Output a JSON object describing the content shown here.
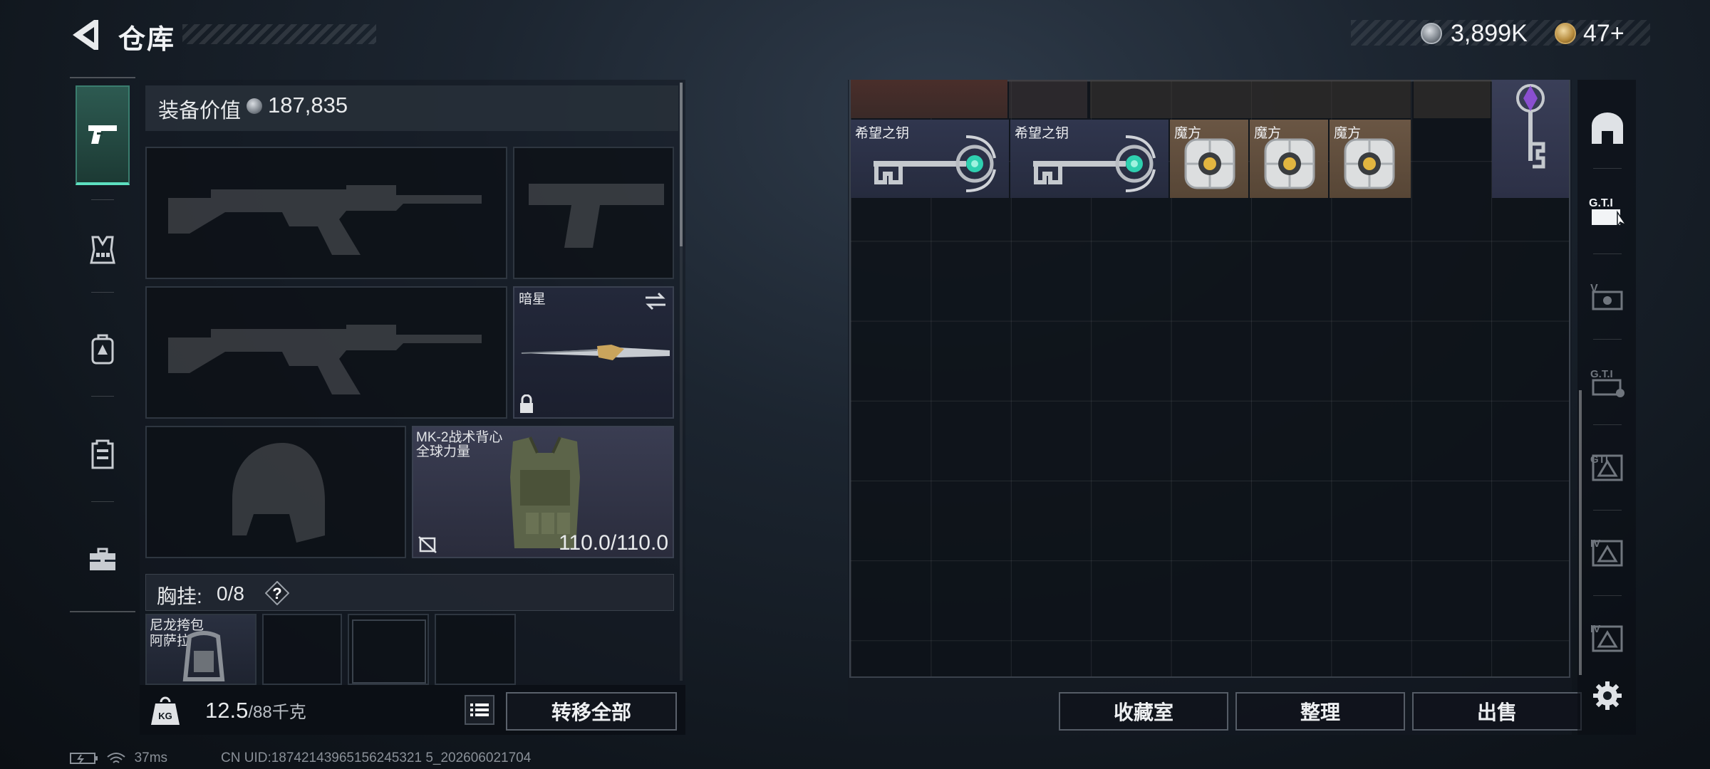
{
  "header": {
    "title": "仓库",
    "money": "3,899K",
    "tickets": "47+"
  },
  "rail": {
    "items": [
      {
        "name": "weapons",
        "active": true
      },
      {
        "name": "vest"
      },
      {
        "name": "backpack"
      },
      {
        "name": "armor"
      },
      {
        "name": "toolbox"
      }
    ]
  },
  "equipment": {
    "value_label": "装备价值",
    "value": "187,835",
    "melee_name": "暗星",
    "vest_name": "MK-2战术背心",
    "vest_brand": "全球力量",
    "vest_durability": "110.0/110.0",
    "chest_label": "胸挂:",
    "chest_count": "0/8",
    "pouch_name": "尼龙挎包",
    "pouch_brand": "阿萨拉"
  },
  "footer": {
    "weight_value": "12.5",
    "weight_max": "/88千克",
    "transfer_all": "转移全部"
  },
  "storage": {
    "items": [
      {
        "label": "希望之钥",
        "type": "key"
      },
      {
        "label": "希望之钥",
        "type": "key"
      },
      {
        "label": "魔方",
        "type": "cube"
      },
      {
        "label": "魔方",
        "type": "cube"
      },
      {
        "label": "魔方",
        "type": "cube"
      }
    ],
    "buttons": {
      "collection": "收藏室",
      "organize": "整理",
      "sell": "出售"
    }
  },
  "status": {
    "ping": "37ms",
    "uid": "CN UID:18742143965156245321 5_202606021704"
  },
  "colors": {
    "accent": "#5de0c0",
    "key_cell": "#2d3550",
    "cube_cell": "#5a4a3a"
  }
}
